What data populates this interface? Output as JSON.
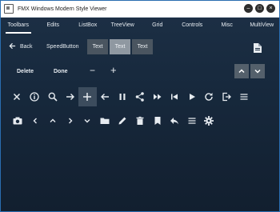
{
  "window": {
    "title": "FMX Windows Modern Style Viewer"
  },
  "tabs": [
    "Toolbars",
    "Edits",
    "ListBox",
    "TreeView",
    "Grid",
    "Controls",
    "Misc",
    "MultiView"
  ],
  "toolbar": {
    "back_label": "Back",
    "speed_label": "SpeedButton",
    "segments": [
      "Text",
      "Text",
      "Text"
    ],
    "delete_label": "Delete",
    "done_label": "Done",
    "minus_label": "−",
    "plus_label": "+"
  }
}
